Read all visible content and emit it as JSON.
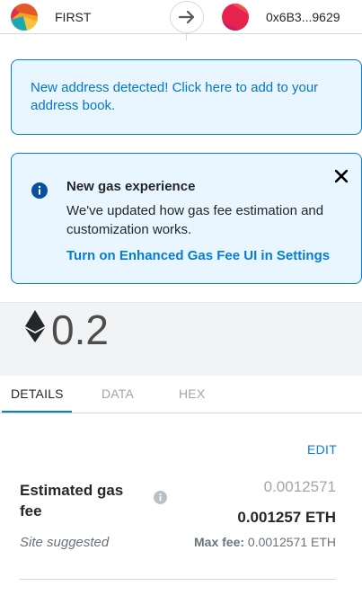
{
  "header": {
    "from_account": "FIRST",
    "to_account": "0x6B3...9629"
  },
  "address_banner": {
    "text": "New address detected! Click here to add to your address book."
  },
  "gas_banner": {
    "title": "New gas experience",
    "body": "We've updated how gas fee estimation and customization works.",
    "link": "Turn on Enhanced Gas Fee UI in Settings"
  },
  "amount": {
    "value": "0.2",
    "icon": "ethereum-icon"
  },
  "tabs": [
    {
      "label": "DETAILS",
      "active": true
    },
    {
      "label": "DATA",
      "active": false
    },
    {
      "label": "HEX",
      "active": false
    }
  ],
  "details": {
    "edit_label": "EDIT",
    "gas_label": "Estimated gas fee",
    "gas_secondary": "0.0012571",
    "gas_primary": "0.001257 ETH",
    "site_suggested": "Site suggested",
    "max_fee_label": "Max fee:",
    "max_fee_value": "0.0012571 ETH"
  },
  "colors": {
    "accent": "#037dd6",
    "banner_bg": "#eaf6ff"
  }
}
